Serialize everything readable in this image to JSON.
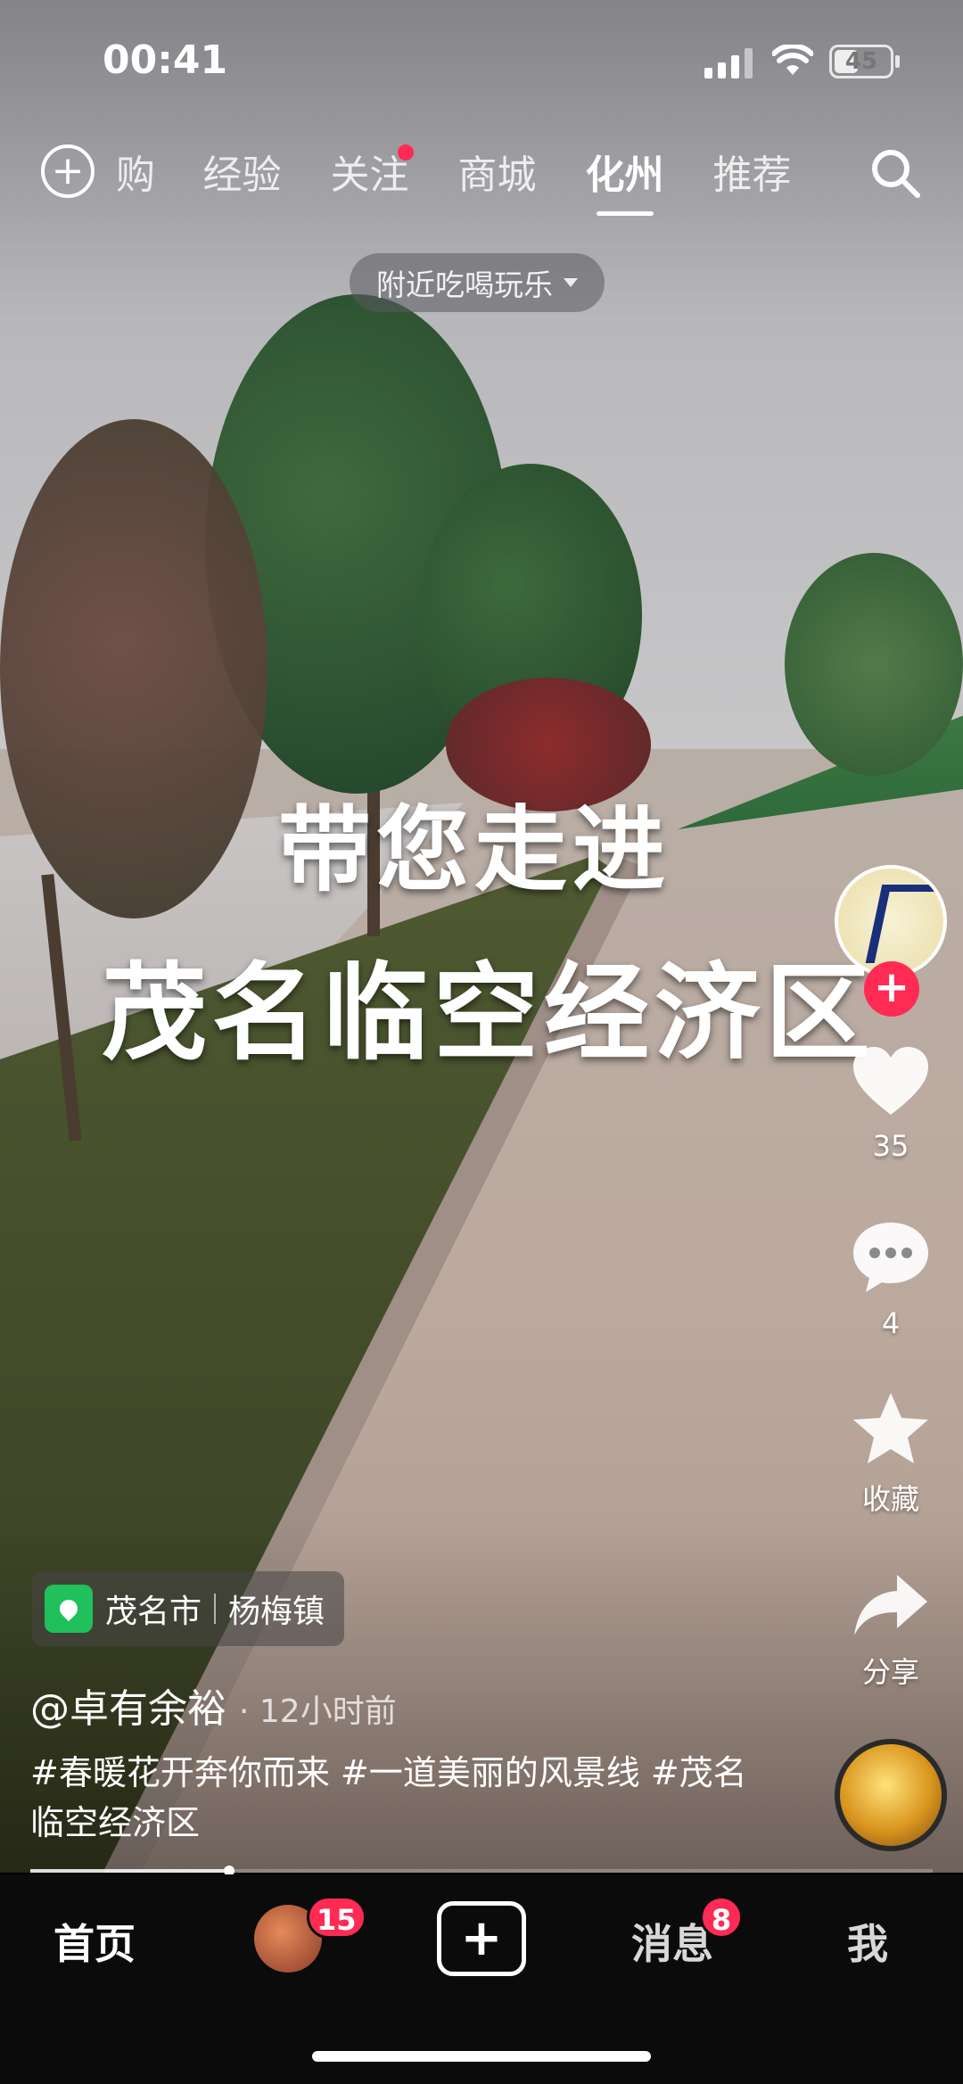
{
  "status": {
    "time": "00:41",
    "battery": "45"
  },
  "topnav": {
    "tabs": [
      {
        "label": "购"
      },
      {
        "label": "经验"
      },
      {
        "label": "关注"
      },
      {
        "label": "商城"
      },
      {
        "label": "化州"
      },
      {
        "label": "推荐"
      }
    ],
    "active_tab": "化州",
    "nearby_label": "附近吃喝玩乐"
  },
  "video": {
    "caption_line1": "带您走进",
    "caption_line2": "茂名临空经济区"
  },
  "rail": {
    "likes": "35",
    "comments": "4",
    "favorite_label": "收藏",
    "share_label": "分享"
  },
  "post": {
    "location_city": "茂名市",
    "location_town": "杨梅镇",
    "author": "@卓有余裕",
    "time_ago": "· 12小时前",
    "description": "#春暖花开奔你而来 #一道美丽的风景线 #茂名临空经济区",
    "progress": 0.22
  },
  "tabbar": {
    "home": "首页",
    "friends_badge": "15",
    "messages": "消息",
    "messages_badge": "8",
    "me": "我"
  }
}
